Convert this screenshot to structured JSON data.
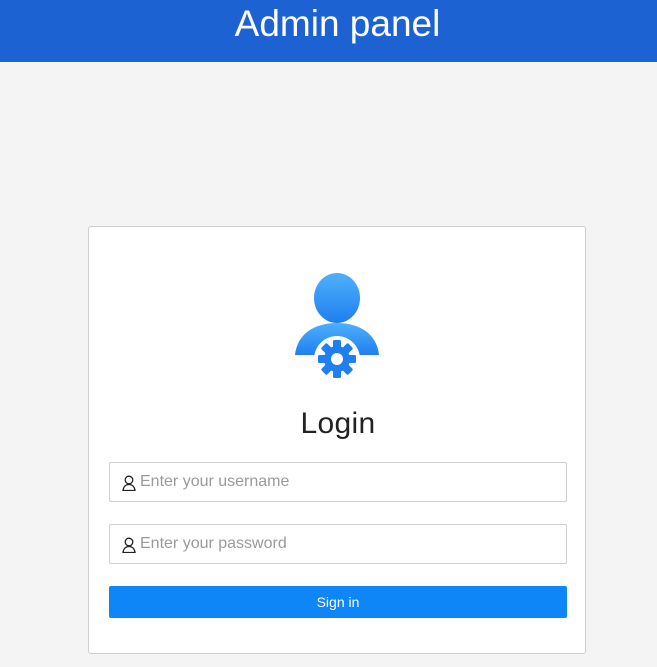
{
  "header": {
    "title": "Admin panel"
  },
  "login": {
    "avatar_icon": "admin-user-gear-icon",
    "heading": "Login",
    "username": {
      "icon": "user-icon",
      "value": "",
      "placeholder": "Enter your username"
    },
    "password": {
      "icon": "user-icon",
      "value": "",
      "placeholder": "Enter your password"
    },
    "submit_label": "Sign in"
  },
  "colors": {
    "header_bg": "#1d62d2",
    "button_bg": "#0f86f7",
    "page_bg": "#f4f4f4",
    "avatar_gradient_top": "#4aa8fb",
    "avatar_gradient_bottom": "#1f7ff0"
  }
}
